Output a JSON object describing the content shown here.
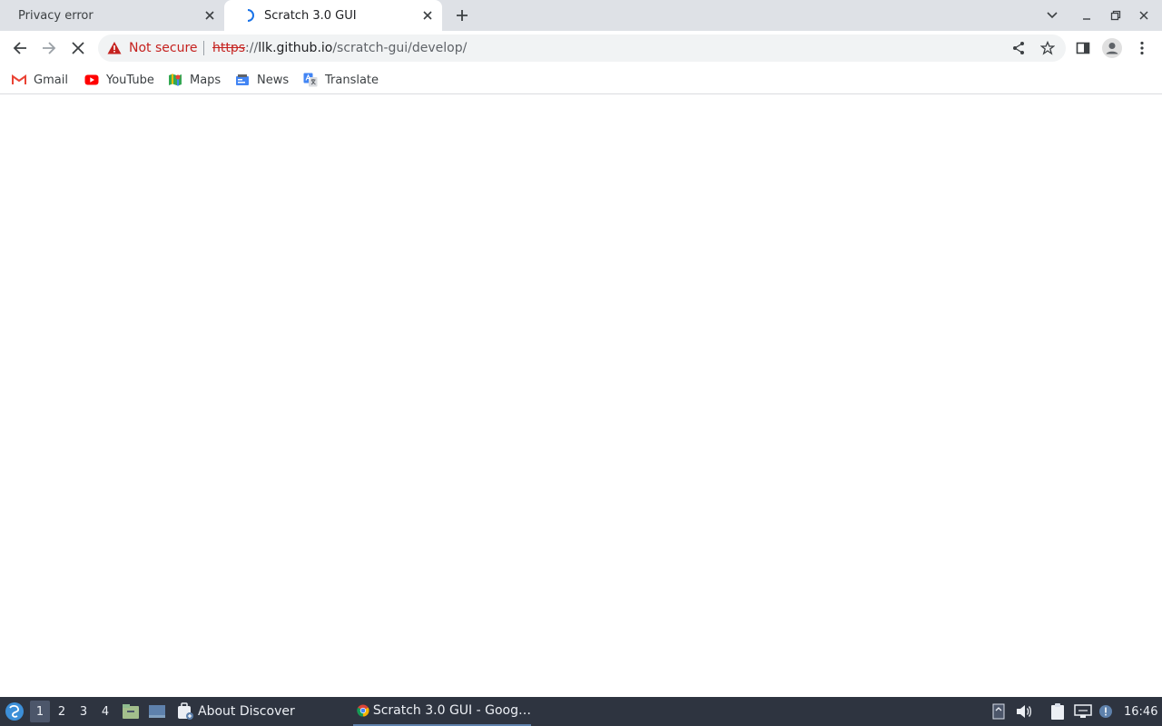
{
  "tabs": [
    {
      "title": "Privacy error",
      "active": false
    },
    {
      "title": "Scratch 3.0 GUI",
      "active": true
    }
  ],
  "toolbar": {
    "security_label": "Not secure",
    "url_scheme": "https",
    "url_sep": "://",
    "url_host": "llk.github.io",
    "url_path": "/scratch-gui/develop/"
  },
  "bookmarks": [
    {
      "label": "Gmail",
      "icon": "gmail-icon"
    },
    {
      "label": "YouTube",
      "icon": "youtube-icon"
    },
    {
      "label": "Maps",
      "icon": "maps-icon"
    },
    {
      "label": "News",
      "icon": "news-icon"
    },
    {
      "label": "Translate",
      "icon": "translate-icon"
    }
  ],
  "taskbar": {
    "workspaces": [
      "1",
      "2",
      "3",
      "4"
    ],
    "active_workspace": "1",
    "tasks": [
      {
        "label": "About Discover",
        "icon": "discover-icon"
      },
      {
        "label": "Scratch 3.0 GUI - Goog…",
        "icon": "chrome-icon",
        "active": true
      }
    ],
    "clock": "16:46"
  },
  "colors": {
    "tabstrip_bg": "#dee1e6",
    "not_secure_red": "#c5221f",
    "taskbar_bg": "#2e3440"
  }
}
